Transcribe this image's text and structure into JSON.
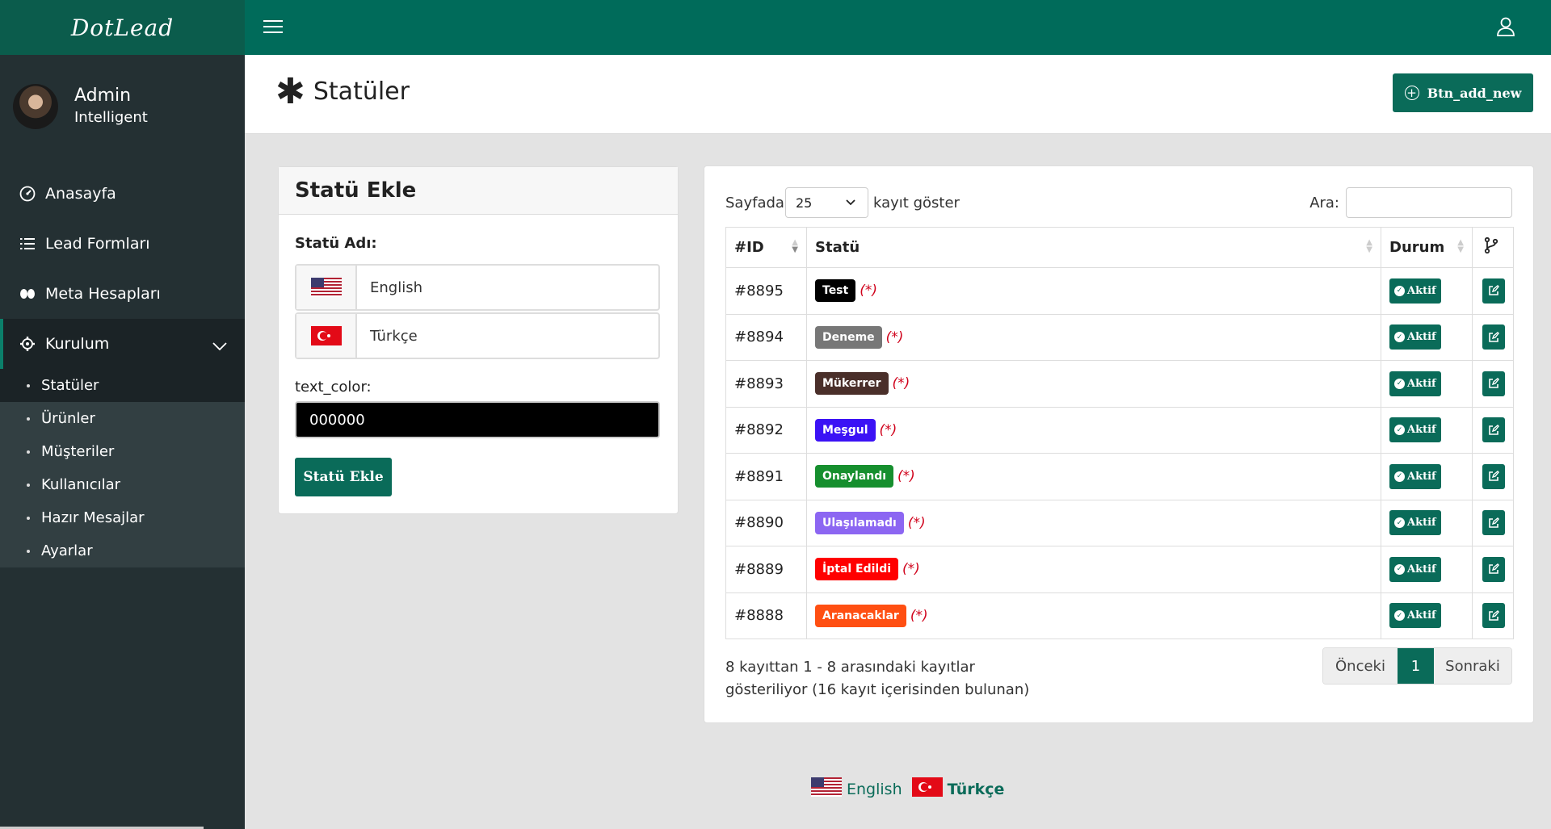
{
  "brand": {
    "logo_text": "DotLead"
  },
  "topbar": {
    "menu_icon": "hamburger-icon",
    "user_icon": "user-icon"
  },
  "profile": {
    "name": "Admin",
    "role": "Intelligent"
  },
  "sidebar": {
    "items": [
      {
        "label": "Anasayfa",
        "icon": "dashboard-icon"
      },
      {
        "label": "Lead Formları",
        "icon": "list-icon"
      },
      {
        "label": "Meta Hesapları",
        "icon": "meta-icon"
      },
      {
        "label": "Kurulum",
        "icon": "gear-icon"
      }
    ],
    "subitems": [
      "Statüler",
      "Ürünler",
      "Müşteriler",
      "Kullanıcılar",
      "Hazır Mesajlar",
      "Ayarlar"
    ]
  },
  "header": {
    "title": "Statüler",
    "add_button": "Btn_add_new"
  },
  "form": {
    "title": "Statü Ekle",
    "name_label": "Statü Adı:",
    "lang_english": "English",
    "lang_turkish": "Türkçe",
    "color_label": "text_color:",
    "color_value": "000000",
    "submit": "Statü Ekle"
  },
  "table_controls": {
    "show_prefix": "Sayfada",
    "page_size": "25",
    "show_suffix": "kayıt göster",
    "search_label": "Ara:"
  },
  "table": {
    "headers": [
      "#ID",
      "Statü",
      "Durum"
    ],
    "required_mark": "(*)",
    "active_label": "Aktif",
    "rows": [
      {
        "id": "#8895",
        "status": "Test",
        "color": "#000000"
      },
      {
        "id": "#8894",
        "status": "Deneme",
        "color": "#777777"
      },
      {
        "id": "#8893",
        "status": "Mükerrer",
        "color": "#4a2f2a"
      },
      {
        "id": "#8892",
        "status": "Meşgul",
        "color": "#3b12f5"
      },
      {
        "id": "#8891",
        "status": "Onaylandı",
        "color": "#168f2e"
      },
      {
        "id": "#8890",
        "status": "Ulaşılamadı",
        "color": "#8c66f2"
      },
      {
        "id": "#8889",
        "status": "İptal Edildi",
        "color": "#ff0000"
      },
      {
        "id": "#8888",
        "status": "Aranacaklar",
        "color": "#ff4f12"
      }
    ]
  },
  "pagination": {
    "info_line1": "8 kayıttan 1 - 8 arasındaki kayıtlar",
    "info_line2": "gösteriliyor (16 kayıt içerisinden bulunan)",
    "prev": "Önceki",
    "current": "1",
    "next": "Sonraki"
  },
  "footer": {
    "english": "English",
    "turkish": "Türkçe"
  },
  "colors": {
    "brand": "#006b5a",
    "button": "#0a6b59",
    "sidebar": "#243033"
  }
}
